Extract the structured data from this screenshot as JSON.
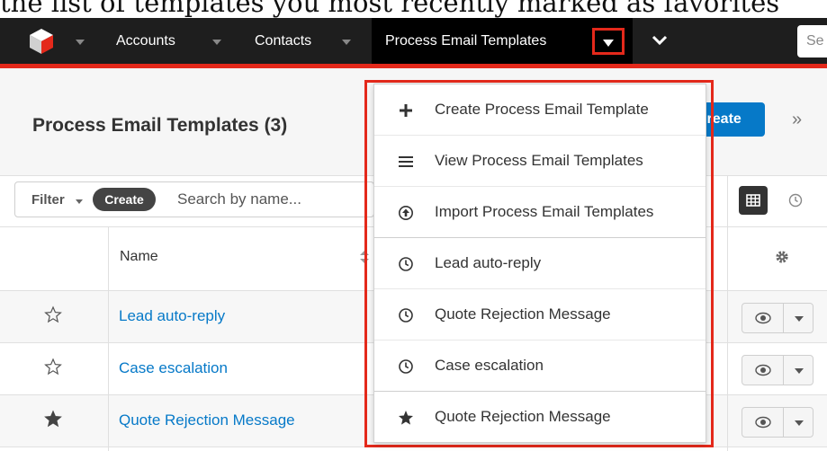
{
  "caption": "the list of templates you most recently marked as favorites",
  "navbar": {
    "logo": "sugarcube-logo-icon",
    "items": [
      {
        "label": "Accounts"
      },
      {
        "label": "Contacts"
      },
      {
        "label": "Process Email Templates"
      }
    ],
    "search_placeholder": "Se"
  },
  "header": {
    "title": "Process Email Templates (3)",
    "create_label": "Create",
    "more_label": "»"
  },
  "filter": {
    "filter_label": "Filter",
    "create_label": "Create",
    "search_placeholder": "Search by name..."
  },
  "table": {
    "column_name": "Name",
    "rows": [
      {
        "name": "Lead auto-reply",
        "favorite": false
      },
      {
        "name": "Case escalation",
        "favorite": false
      },
      {
        "name": "Quote Rejection Message",
        "favorite": true
      }
    ]
  },
  "dropdown": {
    "actions": [
      {
        "label": "Create Process Email Template",
        "icon": "plus-icon"
      },
      {
        "label": "View Process Email Templates",
        "icon": "list-icon"
      },
      {
        "label": "Import Process Email Templates",
        "icon": "import-icon"
      }
    ],
    "recent": [
      {
        "label": "Lead auto-reply",
        "icon": "clock-icon"
      },
      {
        "label": "Quote Rejection Message",
        "icon": "clock-icon"
      },
      {
        "label": "Case escalation",
        "icon": "clock-icon"
      }
    ],
    "favorites": [
      {
        "label": "Quote Rejection Message",
        "icon": "star-icon"
      }
    ]
  },
  "colors": {
    "accent_red": "#e4291b",
    "link_blue": "#0679c8",
    "navbar_bg": "#1e1e1e"
  }
}
